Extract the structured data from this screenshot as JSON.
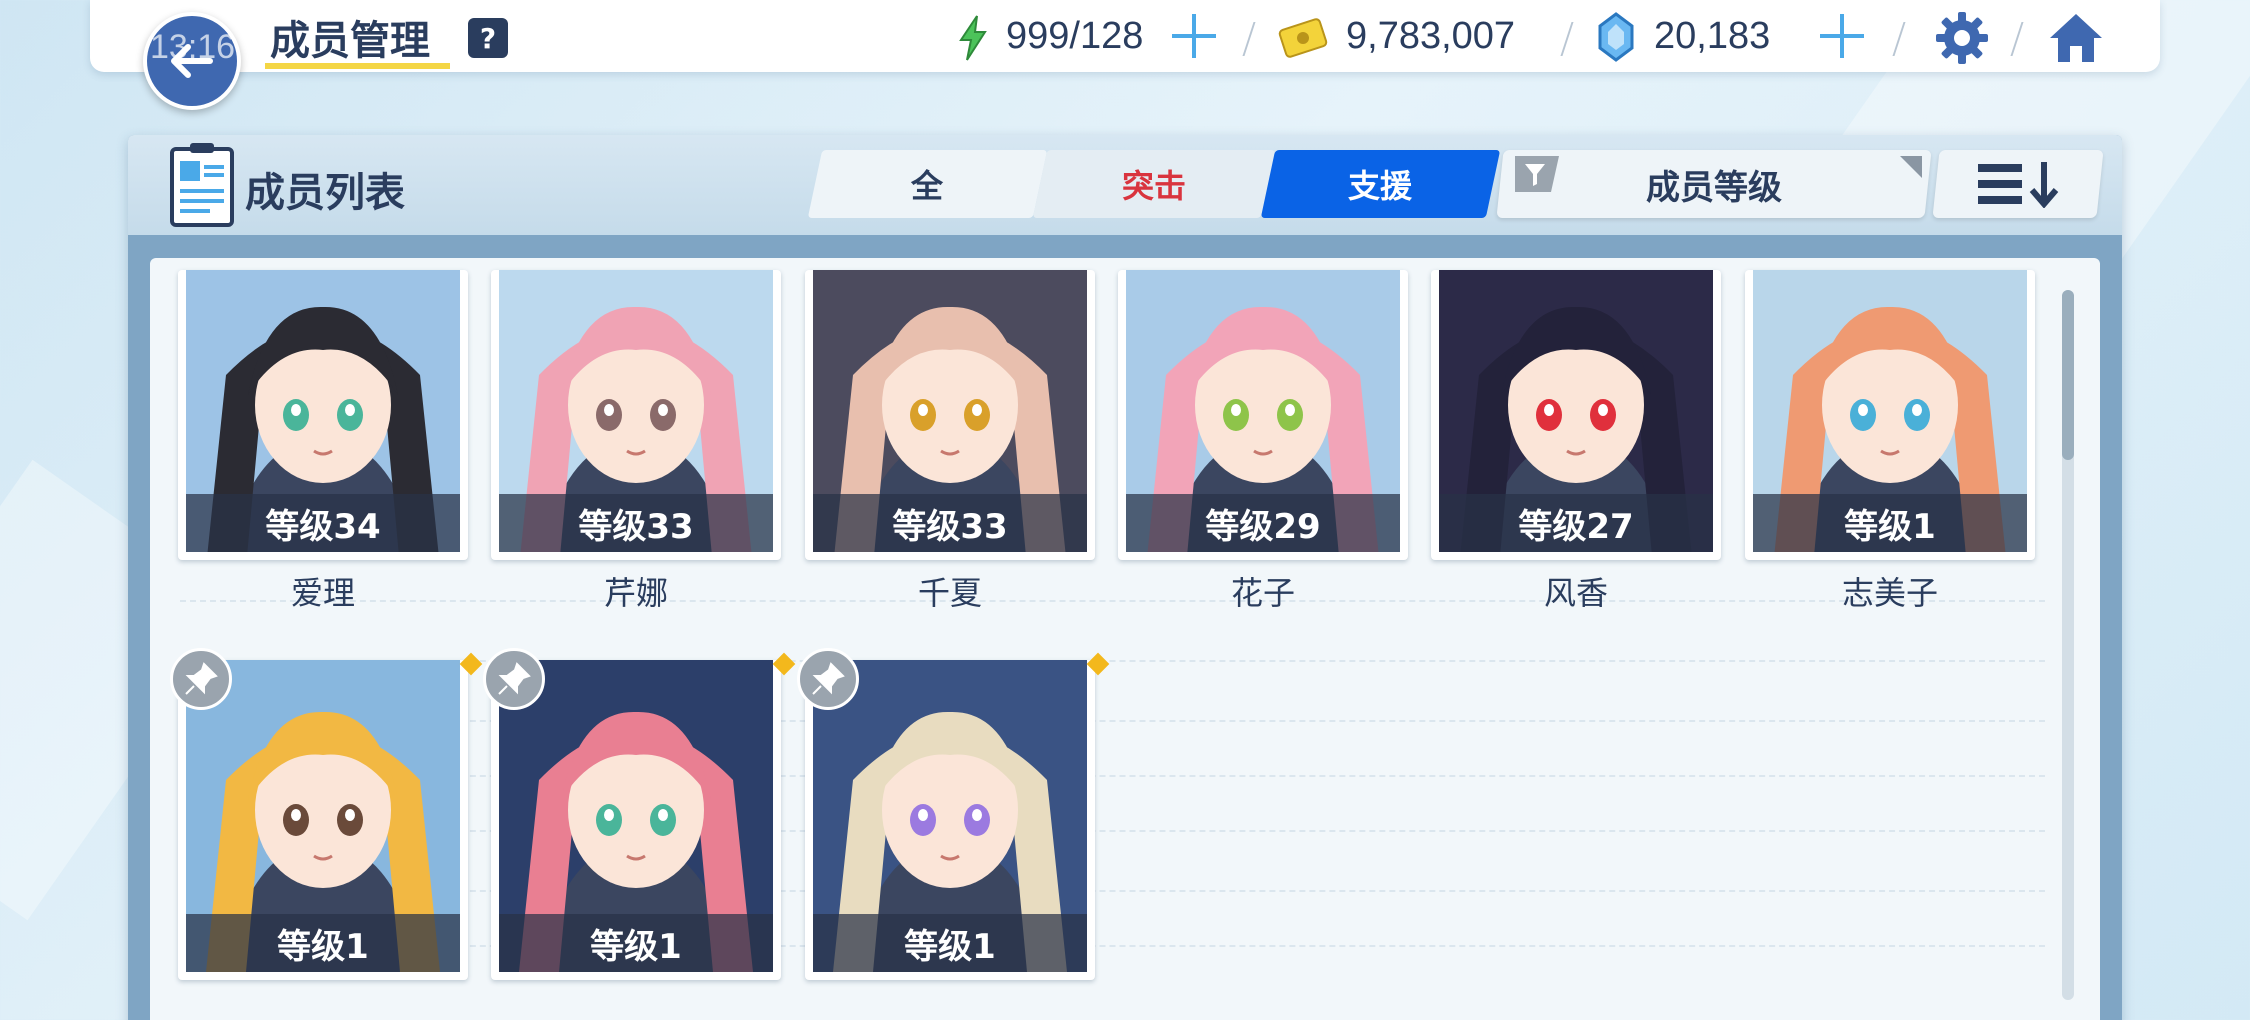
{
  "status": {
    "clock": "13:16"
  },
  "header": {
    "title": "成员管理",
    "help_label": "?",
    "ap": "999/128",
    "credits": "9,783,007",
    "gems": "20,183"
  },
  "panel": {
    "title": "成员列表",
    "tabs": [
      {
        "label": "全",
        "color": "#2a3d5e"
      },
      {
        "label": "突击",
        "color": "#d9343e"
      },
      {
        "label": "支援",
        "color": "#ffffff",
        "active": true
      }
    ],
    "filter_label": "成员等级"
  },
  "members": [
    {
      "level": "等级34",
      "name": "爱理",
      "hair": "#2b2b33",
      "bg": "#9dc3e6",
      "eyes": "#4ab59a"
    },
    {
      "level": "等级33",
      "name": "芹娜",
      "hair": "#f0a3b4",
      "bg": "#bcd9ee",
      "eyes": "#8a6a6a"
    },
    {
      "level": "等级33",
      "name": "千夏",
      "hair": "#e8bfae",
      "bg": "#4c4b5e",
      "eyes": "#d9a02a"
    },
    {
      "level": "等级29",
      "name": "花子",
      "hair": "#f2a4b8",
      "bg": "#a9cbe8",
      "eyes": "#8ec44a"
    },
    {
      "level": "等级27",
      "name": "风香",
      "hair": "#23223a",
      "bg": "#2c2a48",
      "eyes": "#e0303c"
    },
    {
      "level": "等级1",
      "name": "志美子",
      "hair": "#ef9a72",
      "bg": "#b9d6ea",
      "eyes": "#4ab0d8"
    },
    {
      "level": "等级1",
      "name": "",
      "hair": "#f2b843",
      "bg": "#88b7de",
      "eyes": "#6a4a3a"
    },
    {
      "level": "等级1",
      "name": "",
      "hair": "#e97f92",
      "bg": "#2c3f6a",
      "eyes": "#4ab59a"
    },
    {
      "level": "等级1",
      "name": "",
      "hair": "#e8dcc0",
      "bg": "#3a5384",
      "eyes": "#9b7ae0"
    }
  ]
}
